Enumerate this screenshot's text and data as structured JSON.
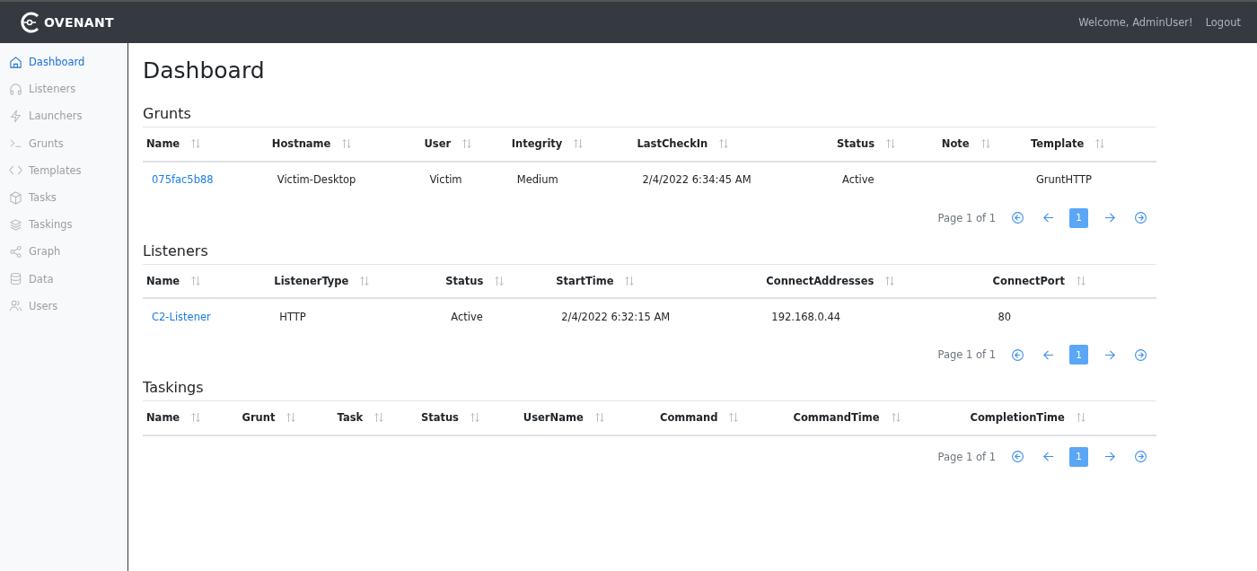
{
  "header": {
    "logo_text": "OVENANT",
    "welcome": "Welcome, AdminUser!",
    "logout": "Logout"
  },
  "sidebar": {
    "items": [
      {
        "label": "Dashboard",
        "selected": true
      },
      {
        "label": "Listeners",
        "selected": false
      },
      {
        "label": "Launchers",
        "selected": false
      },
      {
        "label": "Grunts",
        "selected": false
      },
      {
        "label": "Templates",
        "selected": false
      },
      {
        "label": "Tasks",
        "selected": false
      },
      {
        "label": "Taskings",
        "selected": false
      },
      {
        "label": "Graph",
        "selected": false
      },
      {
        "label": "Data",
        "selected": false
      },
      {
        "label": "Users",
        "selected": false
      }
    ]
  },
  "page_title": "Dashboard",
  "sections": [
    {
      "title": "Grunts",
      "columns": [
        "Name",
        "Hostname",
        "User",
        "Integrity",
        "LastCheckIn",
        "Status",
        "Note",
        "Template"
      ],
      "rows": [
        [
          "075fac5b88",
          "Victim-Desktop",
          "Victim",
          "Medium",
          "2/4/2022 6:34:45 AM",
          "Active",
          "",
          "GruntHTTP"
        ]
      ],
      "pagination": {
        "label": "Page 1 of 1",
        "pages": [
          {
            "label": "1",
            "selected": true
          }
        ]
      }
    },
    {
      "title": "Listeners",
      "columns": [
        "Name",
        "ListenerType",
        "Status",
        "StartTime",
        "ConnectAddresses",
        "ConnectPort"
      ],
      "rows": [
        [
          "C2-Listener",
          "HTTP",
          "Active",
          "2/4/2022 6:32:15 AM",
          "192.168.0.44",
          "80"
        ]
      ],
      "pagination": {
        "label": "Page 1 of 1",
        "pages": [
          {
            "label": "1",
            "selected": true
          }
        ]
      }
    },
    {
      "title": "Taskings",
      "columns": [
        "Name",
        "Grunt",
        "Task",
        "Status",
        "UserName",
        "Command",
        "CommandTime",
        "CompletionTime"
      ],
      "pagination": {
        "label": "Page 1 of 1",
        "pages": [
          {
            "label": "1",
            "selected": true
          }
        ]
      }
    }
  ]
}
